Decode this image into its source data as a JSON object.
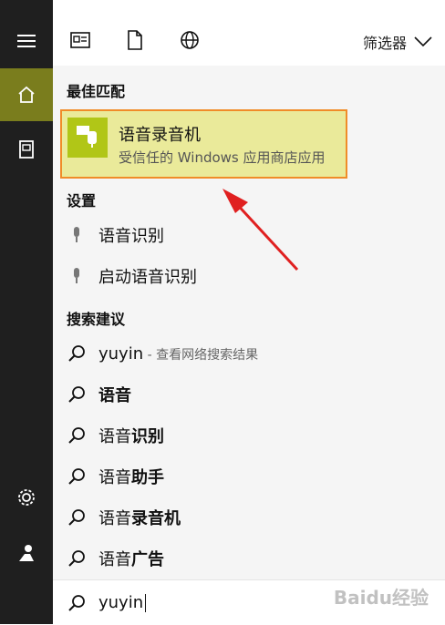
{
  "sidebar": {
    "items": [
      "menu-icon",
      "home-icon",
      "notebook-icon",
      "gear-icon",
      "person-icon"
    ]
  },
  "topbar": {
    "filter_label": "筛选器",
    "icons": [
      "document-list-icon",
      "file-icon",
      "globe-icon"
    ]
  },
  "sections": {
    "best_match": "最佳匹配",
    "settings": "设置",
    "suggestions": "搜索建议"
  },
  "best_match": {
    "title": "语音录音机",
    "subtitle": "受信任的 Windows 应用商店应用",
    "accent": "#b1c617"
  },
  "settings_items": [
    {
      "label": "语音识别"
    },
    {
      "label": "启动语音识别"
    }
  ],
  "suggestions": {
    "first_query": "yuyin",
    "first_hint": " - 查看网络搜索结果",
    "items": [
      {
        "prefix": "语音",
        "suffix": ""
      },
      {
        "prefix": "语音",
        "suffix": "识别"
      },
      {
        "prefix": "语音",
        "suffix": "助手"
      },
      {
        "prefix": "语音",
        "suffix": "录音机"
      },
      {
        "prefix": "语音",
        "suffix": "广告"
      }
    ]
  },
  "search_box": {
    "value": "yuyin"
  },
  "watermark": "Baidu经验",
  "colors": {
    "sidebar_bg": "#1f1f1f",
    "active_bg": "#7a7d1d",
    "highlight_bg": "#eaea9a",
    "highlight_border": "#f08c28",
    "annotation_arrow": "#e02020"
  }
}
